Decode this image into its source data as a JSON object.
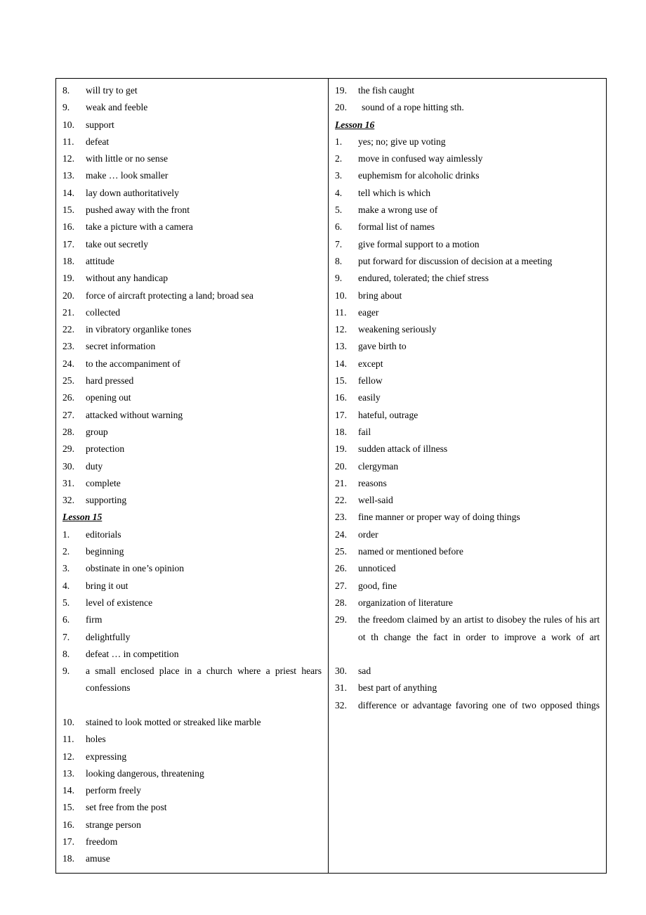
{
  "document": {
    "type": "vocabulary-answer-key",
    "columns": 2
  },
  "left_column": {
    "blocks": [
      {
        "kind": "list",
        "items": [
          {
            "num": "8.",
            "text": "will try to get"
          },
          {
            "num": "9.",
            "text": "weak and feeble"
          },
          {
            "num": "10.",
            "text": "support"
          },
          {
            "num": "11.",
            "text": "defeat"
          },
          {
            "num": "12.",
            "text": "with little or no sense"
          },
          {
            "num": "13.",
            "text": "make … look smaller"
          },
          {
            "num": "14.",
            "text": "lay down authoritatively"
          },
          {
            "num": "15.",
            "text": "pushed away with the front"
          },
          {
            "num": "16.",
            "text": "take a picture with a camera"
          },
          {
            "num": "17.",
            "text": "take out secretly"
          },
          {
            "num": "18.",
            "text": "attitude"
          },
          {
            "num": "19.",
            "text": "without any handicap"
          },
          {
            "num": "20.",
            "text": "force of aircraft protecting a land; broad sea"
          },
          {
            "num": "21.",
            "text": "collected"
          },
          {
            "num": "22.",
            "text": "in vibratory organlike tones"
          },
          {
            "num": "23.",
            "text": "secret information"
          },
          {
            "num": "24.",
            "text": "to the accompaniment of"
          },
          {
            "num": "25.",
            "text": "hard pressed"
          },
          {
            "num": "26.",
            "text": "opening out"
          },
          {
            "num": "27.",
            "text": "attacked without warning"
          },
          {
            "num": "28.",
            "text": "group"
          },
          {
            "num": "29.",
            "text": "protection"
          },
          {
            "num": "30.",
            "text": "duty"
          },
          {
            "num": "31.",
            "text": "complete"
          },
          {
            "num": "32.",
            "text": "supporting"
          }
        ]
      },
      {
        "kind": "heading",
        "label": "Lesson 15"
      },
      {
        "kind": "list",
        "items": [
          {
            "num": "1.",
            "text": "editorials"
          },
          {
            "num": "2.",
            "text": "beginning"
          },
          {
            "num": "3.",
            "text": "obstinate in one’s opinion"
          },
          {
            "num": "4.",
            "text": "bring it out"
          },
          {
            "num": "5.",
            "text": "level of existence"
          },
          {
            "num": "6.",
            "text": "firm"
          },
          {
            "num": "7.",
            "text": "delightfully"
          },
          {
            "num": "8.",
            "text": "defeat … in competition"
          },
          {
            "num": "9.",
            "text": "a small enclosed place in a church where a priest hears confessions",
            "justify": true
          },
          {
            "num": "10.",
            "text": "stained to look motted or streaked like marble"
          },
          {
            "num": "11.",
            "text": "holes"
          },
          {
            "num": "12.",
            "text": "expressing"
          },
          {
            "num": "13.",
            "text": "looking dangerous, threatening"
          },
          {
            "num": "14.",
            "text": "perform freely"
          },
          {
            "num": "15.",
            "text": "set free from the post"
          },
          {
            "num": "16.",
            "text": "strange person"
          },
          {
            "num": "17.",
            "text": "freedom"
          },
          {
            "num": "18.",
            "text": "amuse"
          }
        ]
      }
    ]
  },
  "right_column": {
    "blocks": [
      {
        "kind": "list",
        "items": [
          {
            "num": "19.",
            "text": "the fish caught"
          },
          {
            "num": "20.",
            "text": "sound of a rope hitting sth.",
            "wide_num": true
          }
        ]
      },
      {
        "kind": "heading",
        "label": "Lesson 16"
      },
      {
        "kind": "list",
        "items": [
          {
            "num": "1.",
            "text": "yes; no; give up voting"
          },
          {
            "num": "2.",
            "text": "move in confused way aimlessly"
          },
          {
            "num": "3.",
            "text": "euphemism for alcoholic drinks"
          },
          {
            "num": "4.",
            "text": "tell which is which"
          },
          {
            "num": "5.",
            "text": "make a wrong use of"
          },
          {
            "num": "6.",
            "text": "formal list of names"
          },
          {
            "num": "7.",
            "text": "give formal support to a motion"
          },
          {
            "num": "8.",
            "text": "put forward for discussion of decision at a meeting"
          },
          {
            "num": "9.",
            "text": "endured, tolerated; the chief stress"
          },
          {
            "num": "10.",
            "text": "bring about"
          },
          {
            "num": "11.",
            "text": "eager"
          },
          {
            "num": "12.",
            "text": "weakening seriously"
          },
          {
            "num": "13.",
            "text": "gave birth to"
          },
          {
            "num": "14.",
            "text": "except"
          },
          {
            "num": "15.",
            "text": "fellow"
          },
          {
            "num": "16.",
            "text": "easily"
          },
          {
            "num": "17.",
            "text": "hateful, outrage"
          },
          {
            "num": "18.",
            "text": "fail"
          },
          {
            "num": "19.",
            "text": "sudden attack of illness"
          },
          {
            "num": "20.",
            "text": "clergyman"
          },
          {
            "num": "21.",
            "text": "reasons"
          },
          {
            "num": "22.",
            "text": "well-said"
          },
          {
            "num": "23.",
            "text": "fine manner or proper way of doing things"
          },
          {
            "num": "24.",
            "text": "order"
          },
          {
            "num": "25.",
            "text": "named or mentioned before"
          },
          {
            "num": "26.",
            "text": "unnoticed"
          },
          {
            "num": "27.",
            "text": "good, fine"
          },
          {
            "num": "28.",
            "text": "organization of literature"
          },
          {
            "num": "29.",
            "text": "the freedom claimed by an artist to disobey the rules of his art ot th change the fact in order to improve a work of art",
            "justify": true
          },
          {
            "num": "30.",
            "text": "sad"
          },
          {
            "num": "31.",
            "text": "best part of anything"
          },
          {
            "num": "32.",
            "text": "difference or advantage favoring one of two opposed things",
            "justify": true
          }
        ]
      }
    ]
  }
}
